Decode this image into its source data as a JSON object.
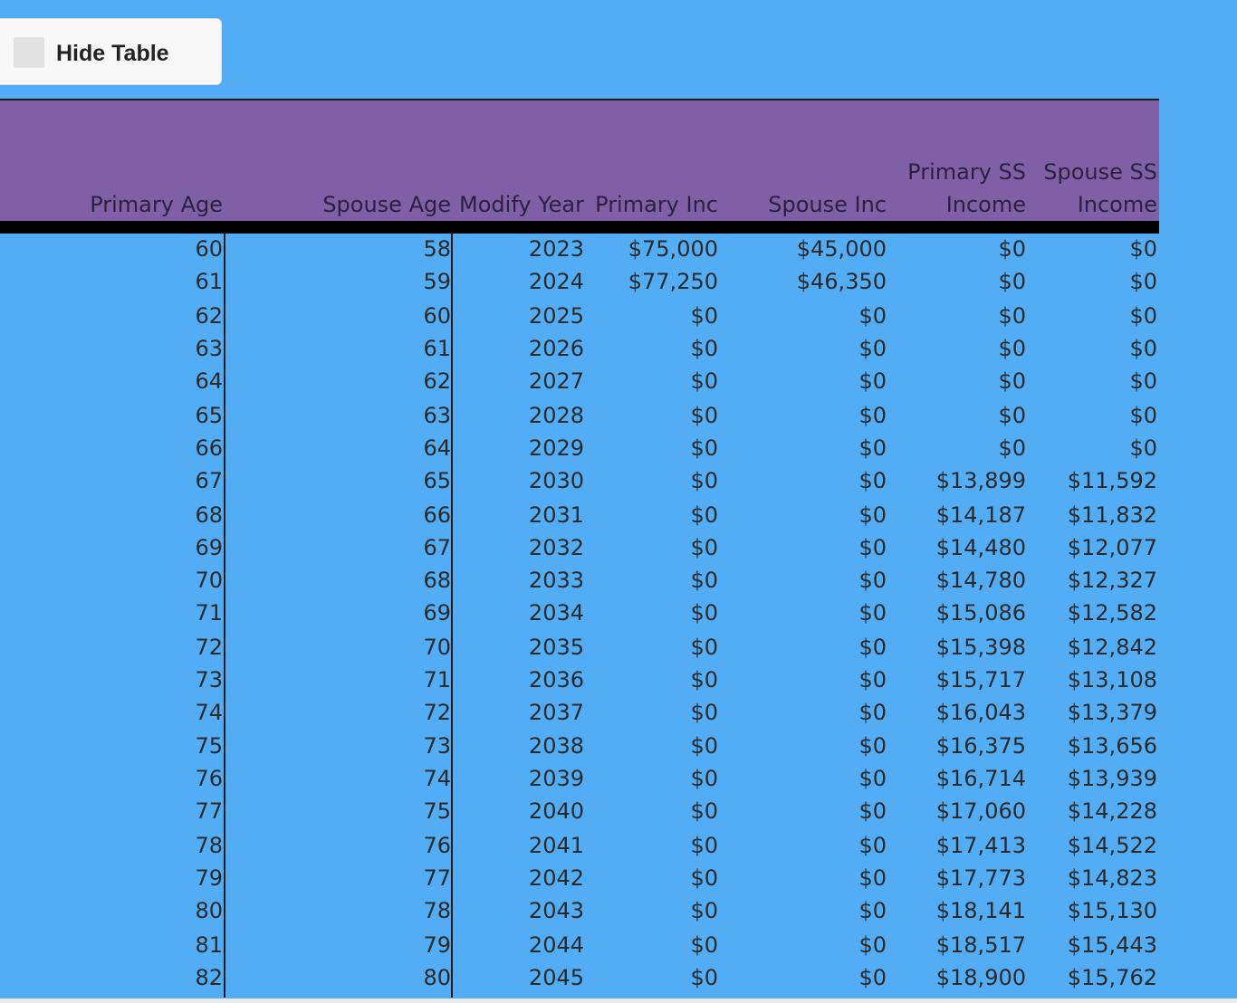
{
  "toggle": {
    "label": "Hide Table"
  },
  "table": {
    "colors": {
      "header_bg": "#7f5fa6",
      "page_bg": "#52adf5"
    },
    "headers": [
      {
        "line1": "",
        "line2": "Primary Age"
      },
      {
        "line1": "",
        "line2": "Spouse Age"
      },
      {
        "line1": "",
        "line2": "Modify Year"
      },
      {
        "line1": "",
        "line2": "Primary Inc"
      },
      {
        "line1": "",
        "line2": "Spouse Inc"
      },
      {
        "line1": "Primary SS",
        "line2": "Income"
      },
      {
        "line1": "Spouse SS",
        "line2": "Income"
      }
    ],
    "rows": [
      [
        "60",
        "58",
        "2023",
        "$75,000",
        "$45,000",
        "$0",
        "$0"
      ],
      [
        "61",
        "59",
        "2024",
        "$77,250",
        "$46,350",
        "$0",
        "$0"
      ],
      [
        "62",
        "60",
        "2025",
        "$0",
        "$0",
        "$0",
        "$0"
      ],
      [
        "63",
        "61",
        "2026",
        "$0",
        "$0",
        "$0",
        "$0"
      ],
      [
        "64",
        "62",
        "2027",
        "$0",
        "$0",
        "$0",
        "$0"
      ],
      [
        "65",
        "63",
        "2028",
        "$0",
        "$0",
        "$0",
        "$0"
      ],
      [
        "66",
        "64",
        "2029",
        "$0",
        "$0",
        "$0",
        "$0"
      ],
      [
        "67",
        "65",
        "2030",
        "$0",
        "$0",
        "$13,899",
        "$11,592"
      ],
      [
        "68",
        "66",
        "2031",
        "$0",
        "$0",
        "$14,187",
        "$11,832"
      ],
      [
        "69",
        "67",
        "2032",
        "$0",
        "$0",
        "$14,480",
        "$12,077"
      ],
      [
        "70",
        "68",
        "2033",
        "$0",
        "$0",
        "$14,780",
        "$12,327"
      ],
      [
        "71",
        "69",
        "2034",
        "$0",
        "$0",
        "$15,086",
        "$12,582"
      ],
      [
        "72",
        "70",
        "2035",
        "$0",
        "$0",
        "$15,398",
        "$12,842"
      ],
      [
        "73",
        "71",
        "2036",
        "$0",
        "$0",
        "$15,717",
        "$13,108"
      ],
      [
        "74",
        "72",
        "2037",
        "$0",
        "$0",
        "$16,043",
        "$13,379"
      ],
      [
        "75",
        "73",
        "2038",
        "$0",
        "$0",
        "$16,375",
        "$13,656"
      ],
      [
        "76",
        "74",
        "2039",
        "$0",
        "$0",
        "$16,714",
        "$13,939"
      ],
      [
        "77",
        "75",
        "2040",
        "$0",
        "$0",
        "$17,060",
        "$14,228"
      ],
      [
        "78",
        "76",
        "2041",
        "$0",
        "$0",
        "$17,413",
        "$14,522"
      ],
      [
        "79",
        "77",
        "2042",
        "$0",
        "$0",
        "$17,773",
        "$14,823"
      ],
      [
        "80",
        "78",
        "2043",
        "$0",
        "$0",
        "$18,141",
        "$15,130"
      ],
      [
        "81",
        "79",
        "2044",
        "$0",
        "$0",
        "$18,517",
        "$15,443"
      ],
      [
        "82",
        "80",
        "2045",
        "$0",
        "$0",
        "$18,900",
        "$15,762"
      ]
    ]
  }
}
